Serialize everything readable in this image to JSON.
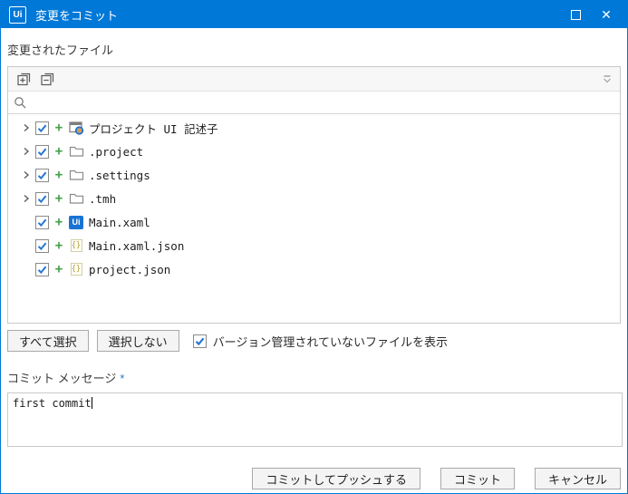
{
  "window": {
    "logo_text": "Ui",
    "title": "変更をコミット"
  },
  "colors": {
    "titlebar_blue": "#0078d7",
    "check_blue": "#2878d2",
    "added_green": "#43a047"
  },
  "files_section": {
    "label": "変更されたファイル",
    "search": {
      "value": "",
      "placeholder": ""
    },
    "tree": [
      {
        "label": "プロジェクト UI 記述子",
        "icon": "ui-descriptors-icon",
        "status": "+",
        "checked": true,
        "expandable": true
      },
      {
        "label": ".project",
        "icon": "folder-icon",
        "status": "+",
        "checked": true,
        "expandable": true
      },
      {
        "label": ".settings",
        "icon": "folder-icon",
        "status": "+",
        "checked": true,
        "expandable": true
      },
      {
        "label": ".tmh",
        "icon": "folder-icon",
        "status": "+",
        "checked": true,
        "expandable": true
      },
      {
        "label": "Main.xaml",
        "icon": "uipath-file-icon",
        "icon_text": "Ui",
        "status": "+",
        "checked": true,
        "expandable": false
      },
      {
        "label": "Main.xaml.json",
        "icon": "json-file-icon",
        "icon_text": "{}",
        "status": "+",
        "checked": true,
        "expandable": false
      },
      {
        "label": "project.json",
        "icon": "json-file-icon",
        "icon_text": "{}",
        "status": "+",
        "checked": true,
        "expandable": false
      }
    ],
    "select_all_label": "すべて選択",
    "select_none_label": "選択しない",
    "show_unversioned": {
      "label": "バージョン管理されていないファイルを表示",
      "checked": true
    }
  },
  "commit_message": {
    "label": "コミット メッセージ",
    "required_marker": "*",
    "value": "first commit"
  },
  "footer": {
    "commit_push_label": "コミットしてプッシュする",
    "commit_label": "コミット",
    "cancel_label": "キャンセル"
  }
}
